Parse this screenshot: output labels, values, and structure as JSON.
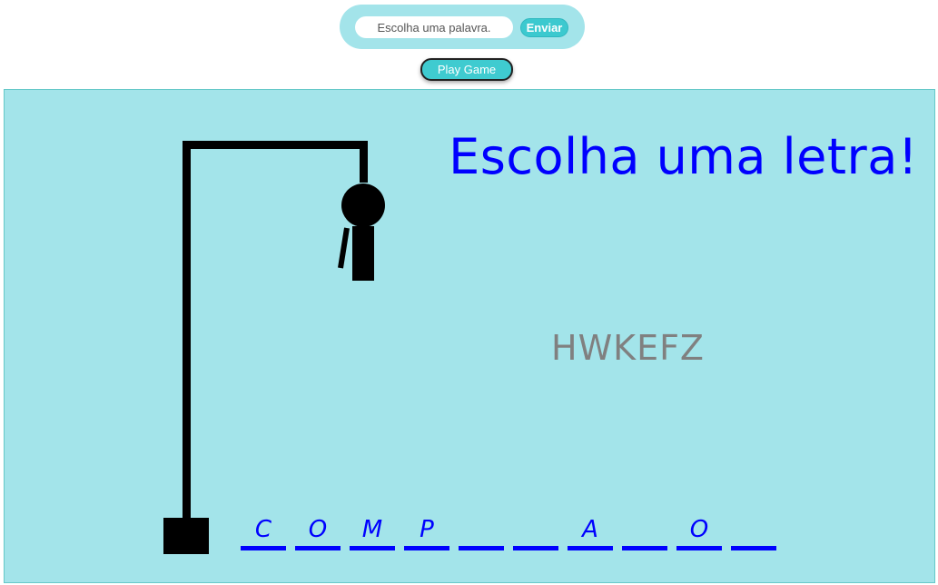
{
  "word_form": {
    "input_placeholder": "Escolha uma palavra.",
    "send_label": "Enviar"
  },
  "play_label": "Play Game",
  "game": {
    "prompt": "Escolha uma letra!",
    "wrong_letters": "HWKEFZ",
    "slots": [
      "C",
      "O",
      "M",
      "P",
      "",
      "",
      "A",
      "",
      "O",
      ""
    ],
    "hangman_parts_drawn": [
      "head",
      "body",
      "left-arm"
    ]
  },
  "colors": {
    "board_background": "#a3e4ea",
    "prompt_text": "#0000ff",
    "wrong_letters_text": "#808080",
    "button_accent": "#3cc9cf"
  }
}
